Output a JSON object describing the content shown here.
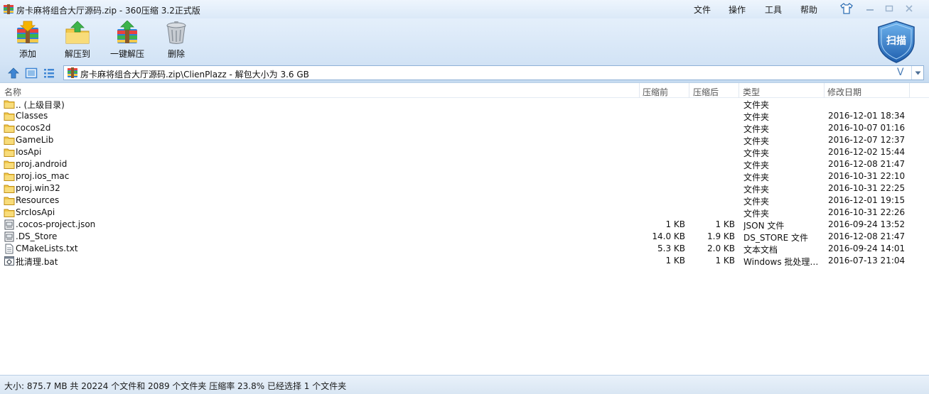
{
  "window": {
    "title": "房卡麻将组合大厅源码.zip - 360压缩 3.2正式版",
    "menu": [
      "文件",
      "操作",
      "工具",
      "帮助"
    ],
    "controls": [
      "minimize",
      "maximize",
      "close"
    ]
  },
  "toolbar": {
    "buttons": [
      {
        "label": "添加",
        "icon": "add-archive-icon"
      },
      {
        "label": "解压到",
        "icon": "extract-to-icon"
      },
      {
        "label": "一键解压",
        "icon": "one-click-extract-icon"
      },
      {
        "label": "删除",
        "icon": "trash-can-icon"
      }
    ],
    "scan_label": "扫描"
  },
  "address": {
    "path": "房卡麻将组合大厅源码.zip\\ClienPlazz - 解包大小为 3.6 GB",
    "v_label": "V"
  },
  "columns": {
    "name": "名称",
    "packed": "压缩前",
    "unpacked": "压缩后",
    "type": "类型",
    "modified": "修改日期"
  },
  "files": [
    {
      "name": ".. (上级目录)",
      "packed": "",
      "unpacked": "",
      "type": "文件夹",
      "modified": "",
      "icon": "folder"
    },
    {
      "name": "Classes",
      "packed": "",
      "unpacked": "",
      "type": "文件夹",
      "modified": "2016-12-01 18:34",
      "icon": "folder"
    },
    {
      "name": "cocos2d",
      "packed": "",
      "unpacked": "",
      "type": "文件夹",
      "modified": "2016-10-07 01:16",
      "icon": "folder"
    },
    {
      "name": "GameLib",
      "packed": "",
      "unpacked": "",
      "type": "文件夹",
      "modified": "2016-12-07 12:37",
      "icon": "folder"
    },
    {
      "name": "IosApi",
      "packed": "",
      "unpacked": "",
      "type": "文件夹",
      "modified": "2016-12-02 15:44",
      "icon": "folder"
    },
    {
      "name": "proj.android",
      "packed": "",
      "unpacked": "",
      "type": "文件夹",
      "modified": "2016-12-08 21:47",
      "icon": "folder"
    },
    {
      "name": "proj.ios_mac",
      "packed": "",
      "unpacked": "",
      "type": "文件夹",
      "modified": "2016-10-31 22:10",
      "icon": "folder"
    },
    {
      "name": "proj.win32",
      "packed": "",
      "unpacked": "",
      "type": "文件夹",
      "modified": "2016-10-31 22:25",
      "icon": "folder"
    },
    {
      "name": "Resources",
      "packed": "",
      "unpacked": "",
      "type": "文件夹",
      "modified": "2016-12-01 19:15",
      "icon": "folder"
    },
    {
      "name": "SrcIosApi",
      "packed": "",
      "unpacked": "",
      "type": "文件夹",
      "modified": "2016-10-31 22:26",
      "icon": "folder"
    },
    {
      "name": ".cocos-project.json",
      "packed": "1 KB",
      "unpacked": "1 KB",
      "type": "JSON 文件",
      "modified": "2016-09-24 13:52",
      "icon": "generic"
    },
    {
      "name": ".DS_Store",
      "packed": "14.0 KB",
      "unpacked": "1.9 KB",
      "type": "DS_STORE 文件",
      "modified": "2016-12-08 21:47",
      "icon": "generic"
    },
    {
      "name": "CMakeLists.txt",
      "packed": "5.3 KB",
      "unpacked": "2.0 KB",
      "type": "文本文档",
      "modified": "2016-09-24 14:01",
      "icon": "text"
    },
    {
      "name": "批清理.bat",
      "packed": "1 KB",
      "unpacked": "1 KB",
      "type": "Windows 批处理…",
      "modified": "2016-07-13 21:04",
      "icon": "bat"
    }
  ],
  "status": {
    "text": "大小: 875.7 MB 共 20224 个文件和 2089 个文件夹 压缩率 23.8% 已经选择 1 个文件夹"
  },
  "colors": {
    "chrome_top": "#e4effb",
    "chrome_bottom": "#d2e3f5",
    "folder": "#f2c94c",
    "accent_blue": "#2f7ed8"
  }
}
